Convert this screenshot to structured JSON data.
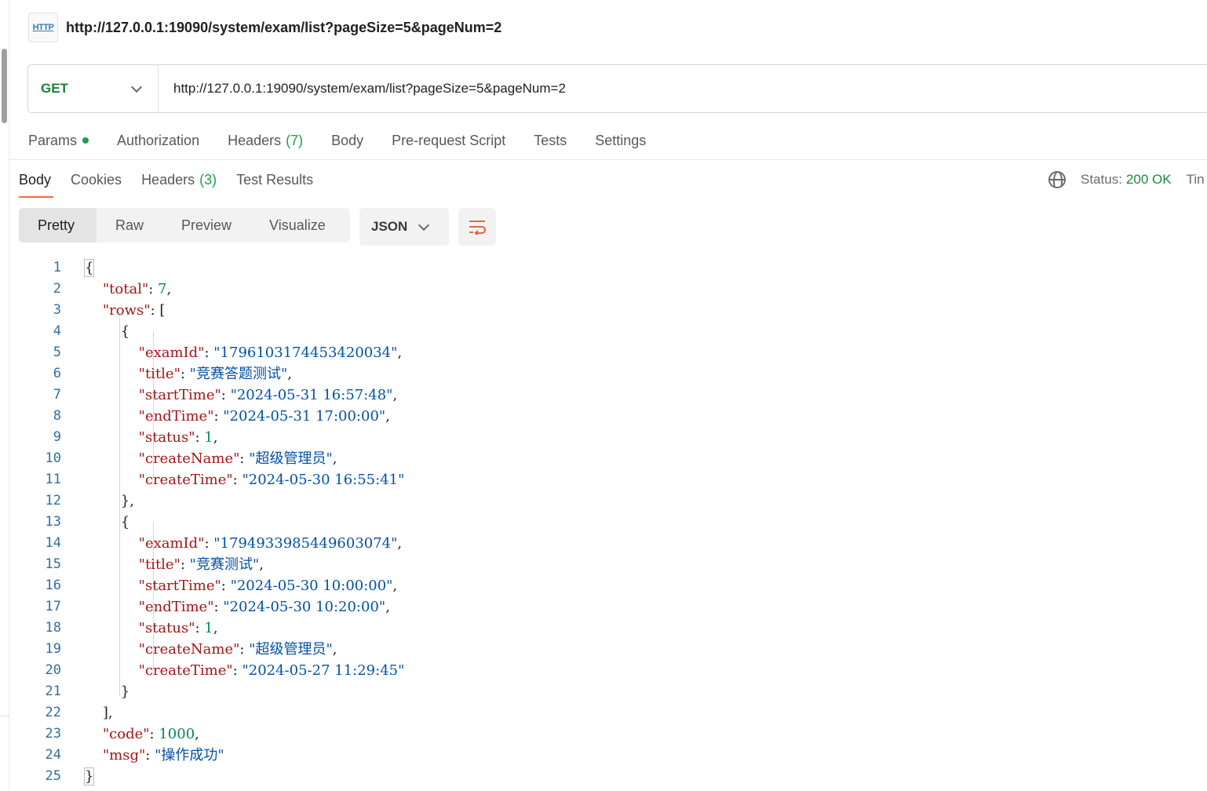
{
  "request": {
    "title": "http://127.0.0.1:19090/system/exam/list?pageSize=5&pageNum=2",
    "icon": "http-icon",
    "method": "GET",
    "url": "http://127.0.0.1:19090/system/exam/list?pageSize=5&pageNum=2"
  },
  "request_tabs": [
    {
      "label": "Params",
      "count": ""
    },
    {
      "label": "Authorization",
      "count": ""
    },
    {
      "label": "Headers",
      "count": "(7)"
    },
    {
      "label": "Body",
      "count": ""
    },
    {
      "label": "Pre-request Script",
      "count": ""
    },
    {
      "label": "Tests",
      "count": ""
    },
    {
      "label": "Settings",
      "count": ""
    }
  ],
  "response_tabs": [
    {
      "label": "Body",
      "count": ""
    },
    {
      "label": "Cookies",
      "count": ""
    },
    {
      "label": "Headers",
      "count": "(3)"
    },
    {
      "label": "Test Results",
      "count": ""
    }
  ],
  "status": {
    "label": "Status:",
    "value": "200 OK",
    "extra": "Tin"
  },
  "view_modes": [
    "Pretty",
    "Raw",
    "Preview",
    "Visualize"
  ],
  "format": "JSON",
  "colors": {
    "key": "#a31515",
    "string": "#0451a5",
    "number": "#098658",
    "accent": "#f26b3a",
    "ok": "#1a8a3c"
  },
  "lines": [
    {
      "n": "1",
      "t": [
        [
          "p",
          "{"
        ]
      ]
    },
    {
      "n": "2",
      "t": [
        [
          "p",
          "    "
        ],
        [
          "k",
          "\"total\""
        ],
        [
          "p",
          ": "
        ],
        [
          "n",
          "7"
        ],
        [
          "p",
          ","
        ]
      ]
    },
    {
      "n": "3",
      "t": [
        [
          "p",
          "    "
        ],
        [
          "k",
          "\"rows\""
        ],
        [
          "p",
          ": ["
        ]
      ]
    },
    {
      "n": "4",
      "t": [
        [
          "p",
          "        {"
        ]
      ]
    },
    {
      "n": "5",
      "t": [
        [
          "p",
          "            "
        ],
        [
          "k",
          "\"examId\""
        ],
        [
          "p",
          ": "
        ],
        [
          "s",
          "\"1796103174453420034\""
        ],
        [
          "p",
          ","
        ]
      ]
    },
    {
      "n": "6",
      "t": [
        [
          "p",
          "            "
        ],
        [
          "k",
          "\"title\""
        ],
        [
          "p",
          ": "
        ],
        [
          "s",
          "\"竞赛答题测试\""
        ],
        [
          "p",
          ","
        ]
      ]
    },
    {
      "n": "7",
      "t": [
        [
          "p",
          "            "
        ],
        [
          "k",
          "\"startTime\""
        ],
        [
          "p",
          ": "
        ],
        [
          "s",
          "\"2024-05-31 16:57:48\""
        ],
        [
          "p",
          ","
        ]
      ]
    },
    {
      "n": "8",
      "t": [
        [
          "p",
          "            "
        ],
        [
          "k",
          "\"endTime\""
        ],
        [
          "p",
          ": "
        ],
        [
          "s",
          "\"2024-05-31 17:00:00\""
        ],
        [
          "p",
          ","
        ]
      ]
    },
    {
      "n": "9",
      "t": [
        [
          "p",
          "            "
        ],
        [
          "k",
          "\"status\""
        ],
        [
          "p",
          ": "
        ],
        [
          "n",
          "1"
        ],
        [
          "p",
          ","
        ]
      ]
    },
    {
      "n": "10",
      "t": [
        [
          "p",
          "            "
        ],
        [
          "k",
          "\"createName\""
        ],
        [
          "p",
          ": "
        ],
        [
          "s",
          "\"超级管理员\""
        ],
        [
          "p",
          ","
        ]
      ]
    },
    {
      "n": "11",
      "t": [
        [
          "p",
          "            "
        ],
        [
          "k",
          "\"createTime\""
        ],
        [
          "p",
          ": "
        ],
        [
          "s",
          "\"2024-05-30 16:55:41\""
        ]
      ]
    },
    {
      "n": "12",
      "t": [
        [
          "p",
          "        },"
        ]
      ]
    },
    {
      "n": "13",
      "t": [
        [
          "p",
          "        {"
        ]
      ]
    },
    {
      "n": "14",
      "t": [
        [
          "p",
          "            "
        ],
        [
          "k",
          "\"examId\""
        ],
        [
          "p",
          ": "
        ],
        [
          "s",
          "\"1794933985449603074\""
        ],
        [
          "p",
          ","
        ]
      ]
    },
    {
      "n": "15",
      "t": [
        [
          "p",
          "            "
        ],
        [
          "k",
          "\"title\""
        ],
        [
          "p",
          ": "
        ],
        [
          "s",
          "\"竞赛测试\""
        ],
        [
          "p",
          ","
        ]
      ]
    },
    {
      "n": "16",
      "t": [
        [
          "p",
          "            "
        ],
        [
          "k",
          "\"startTime\""
        ],
        [
          "p",
          ": "
        ],
        [
          "s",
          "\"2024-05-30 10:00:00\""
        ],
        [
          "p",
          ","
        ]
      ]
    },
    {
      "n": "17",
      "t": [
        [
          "p",
          "            "
        ],
        [
          "k",
          "\"endTime\""
        ],
        [
          "p",
          ": "
        ],
        [
          "s",
          "\"2024-05-30 10:20:00\""
        ],
        [
          "p",
          ","
        ]
      ]
    },
    {
      "n": "18",
      "t": [
        [
          "p",
          "            "
        ],
        [
          "k",
          "\"status\""
        ],
        [
          "p",
          ": "
        ],
        [
          "n",
          "1"
        ],
        [
          "p",
          ","
        ]
      ]
    },
    {
      "n": "19",
      "t": [
        [
          "p",
          "            "
        ],
        [
          "k",
          "\"createName\""
        ],
        [
          "p",
          ": "
        ],
        [
          "s",
          "\"超级管理员\""
        ],
        [
          "p",
          ","
        ]
      ]
    },
    {
      "n": "20",
      "t": [
        [
          "p",
          "            "
        ],
        [
          "k",
          "\"createTime\""
        ],
        [
          "p",
          ": "
        ],
        [
          "s",
          "\"2024-05-27 11:29:45\""
        ]
      ]
    },
    {
      "n": "21",
      "t": [
        [
          "p",
          "        }"
        ]
      ]
    },
    {
      "n": "22",
      "t": [
        [
          "p",
          "    ],"
        ]
      ]
    },
    {
      "n": "23",
      "t": [
        [
          "p",
          "    "
        ],
        [
          "k",
          "\"code\""
        ],
        [
          "p",
          ": "
        ],
        [
          "n",
          "1000"
        ],
        [
          "p",
          ","
        ]
      ]
    },
    {
      "n": "24",
      "t": [
        [
          "p",
          "    "
        ],
        [
          "k",
          "\"msg\""
        ],
        [
          "p",
          ": "
        ],
        [
          "s",
          "\"操作成功\""
        ]
      ]
    },
    {
      "n": "25",
      "t": [
        [
          "p",
          "}"
        ]
      ]
    }
  ]
}
